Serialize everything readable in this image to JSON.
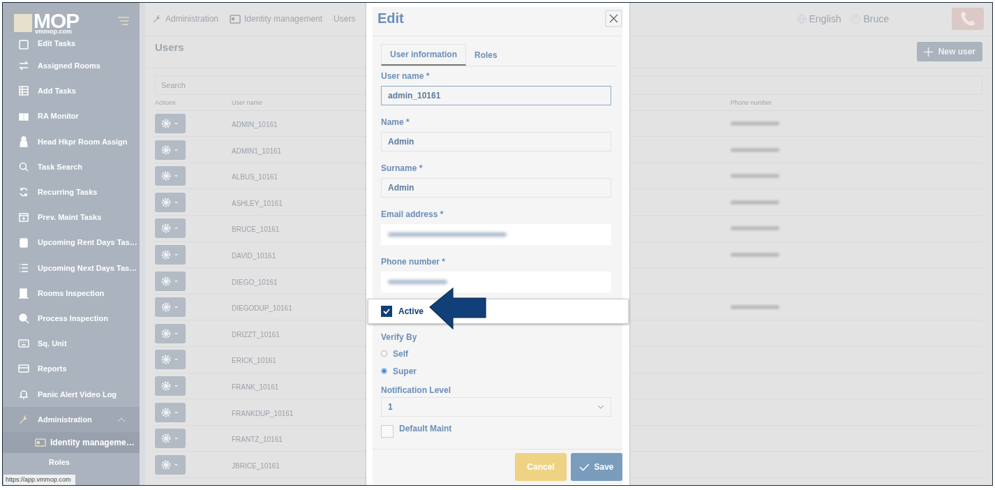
{
  "sidebar": {
    "logo": "MOP",
    "logo_sub": "vmmop.com",
    "items": [
      {
        "label": "Edit Tasks"
      },
      {
        "label": "Assigned Rooms"
      },
      {
        "label": "Add Tasks"
      },
      {
        "label": "RA Monitor"
      },
      {
        "label": "Head Hkpr Room Assign"
      },
      {
        "label": "Task Search"
      },
      {
        "label": "Recurring Tasks"
      },
      {
        "label": "Prev. Maint Tasks"
      },
      {
        "label": "Upcoming Rent Days Tas…"
      },
      {
        "label": "Upcoming Next Days Tas…"
      },
      {
        "label": "Rooms Inspection"
      },
      {
        "label": "Process Inspection"
      },
      {
        "label": "Sq. Unit"
      },
      {
        "label": "Reports"
      },
      {
        "label": "Panic Alert Video Log"
      },
      {
        "label": "Administration",
        "expanded": true,
        "children": [
          {
            "label": "Identity manageme…",
            "expanded": true,
            "children": [
              {
                "label": "Roles"
              }
            ]
          }
        ]
      }
    ]
  },
  "status_url": "https://app.vmmop.com",
  "breadcrumbs": [
    "Administration",
    "Identity management",
    "Users"
  ],
  "header": {
    "language": "English",
    "user": "Bruce"
  },
  "page_title": "Users",
  "new_user_button": "New user",
  "search": {
    "placeholder": "Search"
  },
  "table": {
    "columns": [
      "Actions",
      "User name",
      "Phone number"
    ],
    "rows": [
      {
        "user_name": "ADMIN_10161",
        "phone_blurred": true
      },
      {
        "user_name": "ADMIN1_10161",
        "phone_blurred": true
      },
      {
        "user_name": "ALBUS_10161",
        "phone_blurred": true
      },
      {
        "user_name": "ASHLEY_10161",
        "phone_blurred": true
      },
      {
        "user_name": "BRUCE_10161",
        "phone_blurred": true
      },
      {
        "user_name": "DAVID_10161",
        "phone_blurred": true
      },
      {
        "user_name": "DIEGO_10161",
        "phone_blurred": false
      },
      {
        "user_name": "DIEGODUP_10161",
        "phone_blurred": true
      },
      {
        "user_name": "DRIZZT_10161",
        "phone_blurred": false
      },
      {
        "user_name": "ERICK_10161",
        "phone_blurred": false
      },
      {
        "user_name": "FRANK_10161",
        "phone_blurred": false
      },
      {
        "user_name": "FRANKDUP_10161",
        "phone_blurred": false
      },
      {
        "user_name": "FRANTZ_10161",
        "phone_blurred": false
      },
      {
        "user_name": "JBRICE_10161",
        "phone_blurred": false
      }
    ]
  },
  "dialog": {
    "title": "Edit",
    "tabs": [
      {
        "label": "User information",
        "selected": true
      },
      {
        "label": "Roles",
        "selected": false
      }
    ],
    "fields": [
      {
        "label": "User name *",
        "value": "admin_10161",
        "focused": true,
        "blurred": false
      },
      {
        "label": "Name *",
        "value": "Admin",
        "focused": false,
        "blurred": false
      },
      {
        "label": "Surname *",
        "value": "Admin",
        "focused": false,
        "blurred": false
      },
      {
        "label": "Email address *",
        "focused": false,
        "blurred": true
      },
      {
        "label": "Phone number *",
        "focused": false,
        "blurred": true
      }
    ],
    "active": {
      "label": "Active",
      "checked": true
    },
    "verify_by": {
      "label": "Verify By",
      "options": [
        {
          "label": "Self",
          "selected": false
        },
        {
          "label": "Super",
          "selected": true
        }
      ]
    },
    "notification_level": {
      "label": "Notification Level",
      "value": "1"
    },
    "default_maint": {
      "label": "Default Maint",
      "checked": false
    },
    "buttons": {
      "cancel": "Cancel",
      "save": "Save"
    }
  }
}
